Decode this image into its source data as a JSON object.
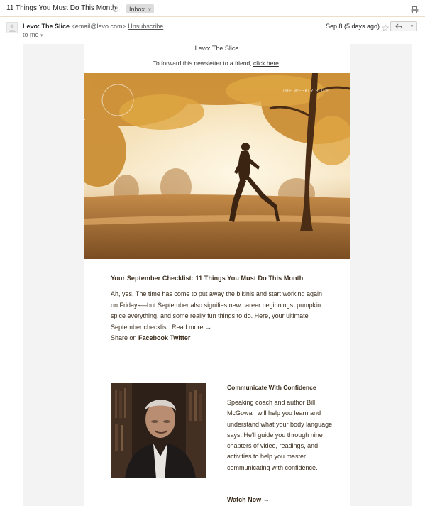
{
  "email": {
    "subject": "11 Things You Must Do This Month",
    "label": "Inbox",
    "label_remove": "x",
    "sender": {
      "name": "Levo: The Slice",
      "address": "<email@levo.com>",
      "unsubscribe": "Unsubscribe",
      "to": "to me"
    },
    "date": "Sep 8 (5 days ago)"
  },
  "newsletter": {
    "brand_title": "Levo: The Slice",
    "forward_prefix": "To forward this newsletter to a friend, ",
    "forward_link": "click here",
    "forward_suffix": ".",
    "hero_overlay_text": "THE WEEKLY SLICE",
    "article": {
      "title": "Your September Checklist: 11 Things You Must Do This Month",
      "body": "Ah, yes. The time has come to put away the bikinis and start working again on Fridays—but September also signifies new career beginnings, pumpkin spice everything, and some really fun things to do. Here, your ultimate September checklist. Read more →",
      "share_prefix": "Share on ",
      "share_facebook": "Facebook",
      "share_twitter": "Twitter"
    },
    "promo": {
      "title": "Communicate With Confidence",
      "body": "Speaking coach and author Bill McGowan will help you learn and understand what your body language says. He'll guide you through nine chapters of video, readings, and activities to help you master communicating with confidence.",
      "cta": "Watch Now →"
    }
  },
  "icons": {
    "mute": "mute-icon",
    "print": "print-icon",
    "star": "star-icon",
    "reply": "reply-icon",
    "more": "chevron-down-icon",
    "avatar": "avatar-icon"
  },
  "colors": {
    "text_brown": "#3a2c1c",
    "chip_gray": "#dddddd",
    "page_gray": "#f3f3f3"
  }
}
